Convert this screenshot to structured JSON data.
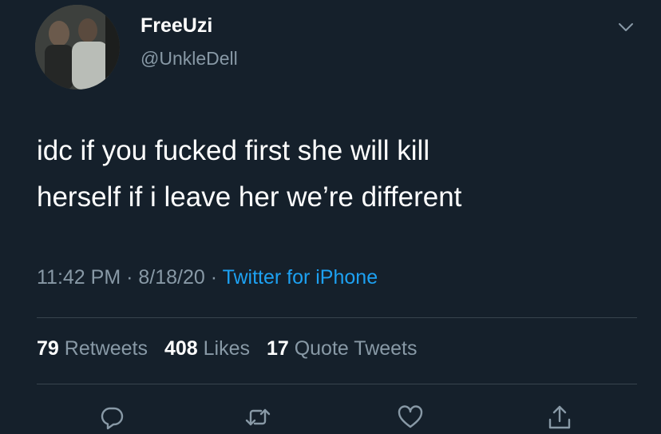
{
  "user": {
    "display_name": "FreeUzi",
    "handle": "@UnkleDell"
  },
  "tweet": {
    "text": "idc if you fucked first she will kill\nherself if i leave her we’re different",
    "time": "11:42 PM",
    "date": "8/18/20",
    "source": "Twitter for iPhone",
    "separator": " · "
  },
  "stats": {
    "retweets_count": "79",
    "retweets_label": "Retweets",
    "likes_count": "408",
    "likes_label": "Likes",
    "quotes_count": "17",
    "quotes_label": "Quote Tweets"
  },
  "actions": [
    "reply-icon",
    "retweet-icon",
    "like-icon",
    "share-icon"
  ],
  "colors": {
    "background": "#15202b",
    "text": "#ffffff",
    "secondary": "#8899a6",
    "link": "#1da1f2",
    "divider": "#38444d"
  }
}
